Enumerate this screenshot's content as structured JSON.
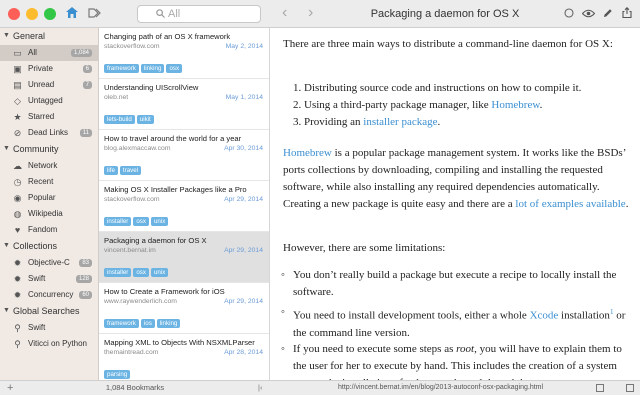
{
  "toolbar": {
    "search_placeholder": "All",
    "nav_back": "‹",
    "nav_forward": "›",
    "doc_title": "Packaging a daemon for OS X"
  },
  "sidebar": {
    "sections": [
      {
        "label": "General",
        "items": [
          {
            "label": "All",
            "count": "1,084",
            "icon": "folder-icon"
          },
          {
            "label": "Private",
            "count": "6",
            "icon": "lock-icon"
          },
          {
            "label": "Unread",
            "count": "7",
            "icon": "tray-icon"
          },
          {
            "label": "Untagged",
            "count": "",
            "icon": "tag-icon"
          },
          {
            "label": "Starred",
            "count": "",
            "icon": "star-icon"
          },
          {
            "label": "Dead Links",
            "count": "11",
            "icon": "broken-link-icon"
          }
        ]
      },
      {
        "label": "Community",
        "items": [
          {
            "label": "Network",
            "count": "",
            "icon": "cloud-icon"
          },
          {
            "label": "Recent",
            "count": "",
            "icon": "clock-icon"
          },
          {
            "label": "Popular",
            "count": "",
            "icon": "popular-icon"
          },
          {
            "label": "Wikipedia",
            "count": "",
            "icon": "globe-icon"
          },
          {
            "label": "Fandom",
            "count": "",
            "icon": "heart-icon"
          }
        ]
      },
      {
        "label": "Collections",
        "items": [
          {
            "label": "Objective-C",
            "count": "83",
            "icon": "gear-icon"
          },
          {
            "label": "Swift",
            "count": "128",
            "icon": "gear-icon"
          },
          {
            "label": "Concurrency",
            "count": "60",
            "icon": "gear-icon"
          }
        ]
      },
      {
        "label": "Global Searches",
        "items": [
          {
            "label": "Swift",
            "count": "",
            "icon": "search-icon"
          },
          {
            "label": "Viticci on Python",
            "count": "",
            "icon": "search-icon"
          }
        ]
      }
    ]
  },
  "bookmarks": [
    {
      "title": "Changing path of an OS X framework",
      "url": "stackoverflow.com",
      "date": "May 2, 2014",
      "tags": [
        "framework",
        "linking",
        "osx"
      ]
    },
    {
      "title": "Understanding UIScrollView",
      "url": "oleb.net",
      "date": "May 1, 2014",
      "tags": [
        "lets-build",
        "uikit"
      ]
    },
    {
      "title": "How to travel around the world for a year",
      "url": "blog.alexmaccaw.com",
      "date": "Apr 30, 2014",
      "tags": [
        "life",
        "travel"
      ]
    },
    {
      "title": "Making OS X Installer Packages like a Pro",
      "url": "stackoverflow.com",
      "date": "Apr 29, 2014",
      "tags": [
        "installer",
        "osx",
        "unix"
      ]
    },
    {
      "title": "Packaging a daemon for OS X",
      "url": "vincent.bernat.im",
      "date": "Apr 29, 2014",
      "tags": [
        "installer",
        "osx",
        "unix"
      ]
    },
    {
      "title": "How to Create a Framework for iOS",
      "url": "www.raywenderlich.com",
      "date": "Apr 29, 2014",
      "tags": [
        "framework",
        "ios",
        "linking"
      ]
    },
    {
      "title": "Mapping XML to Objects With NSXMLParser",
      "url": "themaintread.com",
      "date": "Apr 28, 2014",
      "tags": [
        "parsing"
      ]
    }
  ],
  "article": {
    "p1": "There are three main ways to distribute a command-line daemon for OS X:",
    "ol": [
      {
        "n": "1.",
        "text": "Distributing source code and instructions on how to compile it.",
        "link": ""
      },
      {
        "n": "2.",
        "text": "Using a third-party package manager, like ",
        "link": "Homebrew",
        "after": "."
      },
      {
        "n": "3.",
        "text": "Providing an ",
        "link": "installer package",
        "after": "."
      }
    ],
    "p2_link": "Homebrew",
    "p2_text": " is a popular package management system. It works like the BSDs’ ports collections by downloading, compiling and installing the requested software, while also installing any required dependencies automatically. Creating a new package is quite easy and there are a ",
    "p2_link2": "lot of examples available",
    "p2_end": ".",
    "p3": "However, there are some limitations:",
    "b1": "You don’t really build a package but execute a recipe to locally install the software.",
    "b2_a": "You need to install development tools, either a whole ",
    "b2_link": "Xcode",
    "b2_b": " installation",
    "b2_sup": "1",
    "b2_c": " or the command line version.",
    "b3_a": "If you need to execute some steps as ",
    "b3_em": "root",
    "b3_b": ", you will have to explain them to the user for her to execute by hand. This includes the creation of a system user or the installation of a daemon through launchd."
  },
  "statusbar": {
    "count": "1,084 Bookmarks",
    "url": "http://vincent.bernat.im/en/blog/2013-autoconf-osx-packaging.html"
  },
  "colors": {
    "accent": "#3a8fd1",
    "tag": "#6ab3e3",
    "sidebar": "#f0e9e4",
    "close": "#fc5f57",
    "minimize": "#fdbc2e",
    "zoom": "#33c748"
  }
}
